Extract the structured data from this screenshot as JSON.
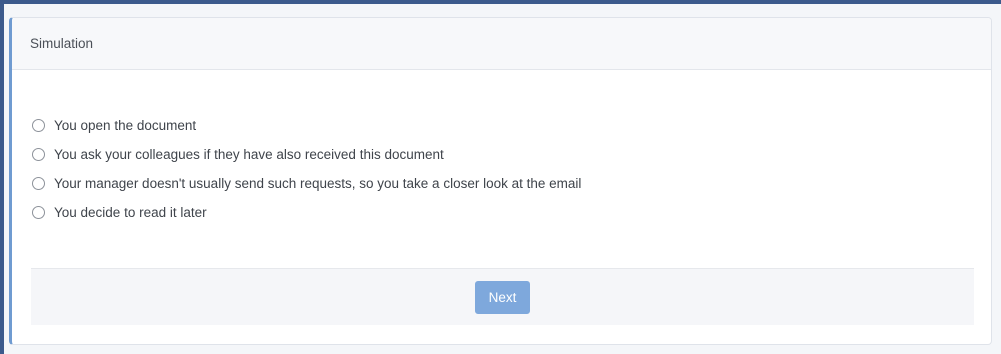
{
  "card": {
    "title": "Simulation"
  },
  "options": [
    {
      "label": "You open the document",
      "selected": false
    },
    {
      "label": "You ask your colleagues if they have also received this document",
      "selected": false
    },
    {
      "label": "Your manager doesn't usually send such requests, so you take a closer look at the email",
      "selected": false
    },
    {
      "label": "You decide to read it later",
      "selected": false
    }
  ],
  "footer": {
    "next_label": "Next"
  },
  "colors": {
    "accent": "#7ea8dc",
    "card_border_accent": "#6f9bd1",
    "frame": "#3c5a8c"
  }
}
